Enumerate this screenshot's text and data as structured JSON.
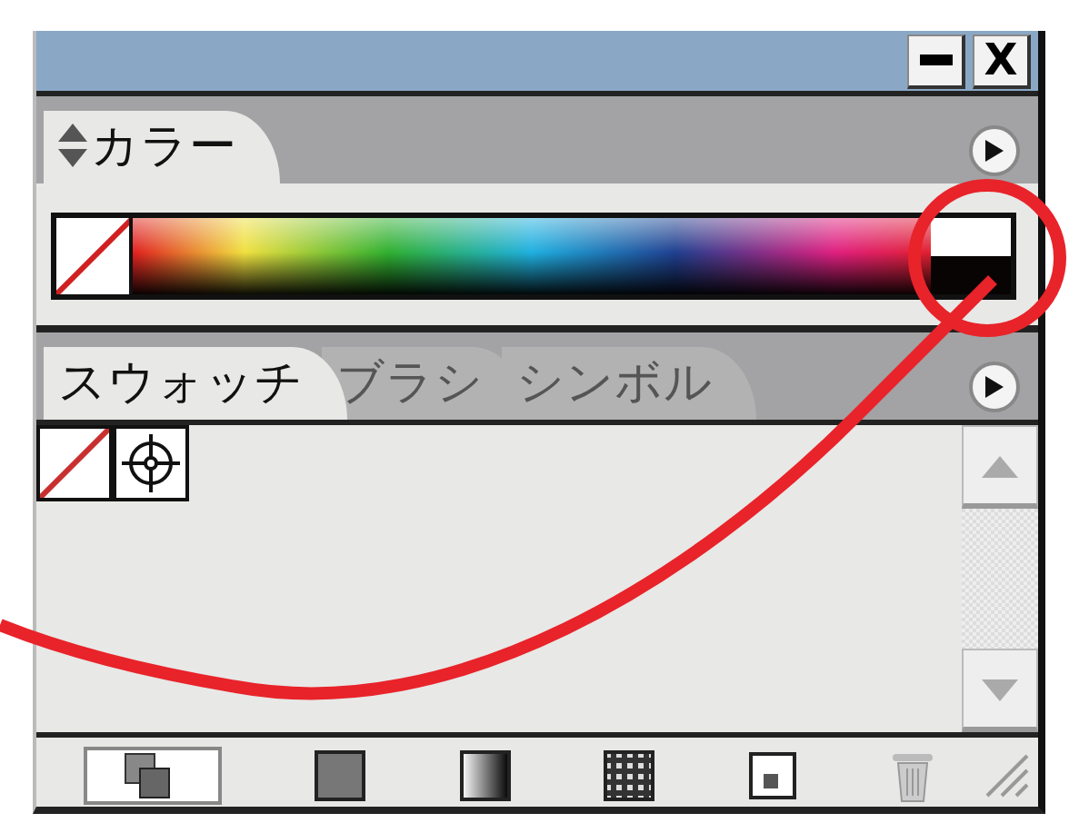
{
  "window": {
    "close_label": "X"
  },
  "color_panel": {
    "tabs": [
      {
        "label": "カラー",
        "selected": true
      }
    ]
  },
  "swatches_panel": {
    "tabs": [
      {
        "label": "スウォッチ",
        "selected": true
      },
      {
        "label": "ブラシ",
        "selected": false
      },
      {
        "label": "シンボル",
        "selected": false
      }
    ],
    "swatches": [
      {
        "kind": "none"
      },
      {
        "kind": "registration"
      }
    ]
  }
}
